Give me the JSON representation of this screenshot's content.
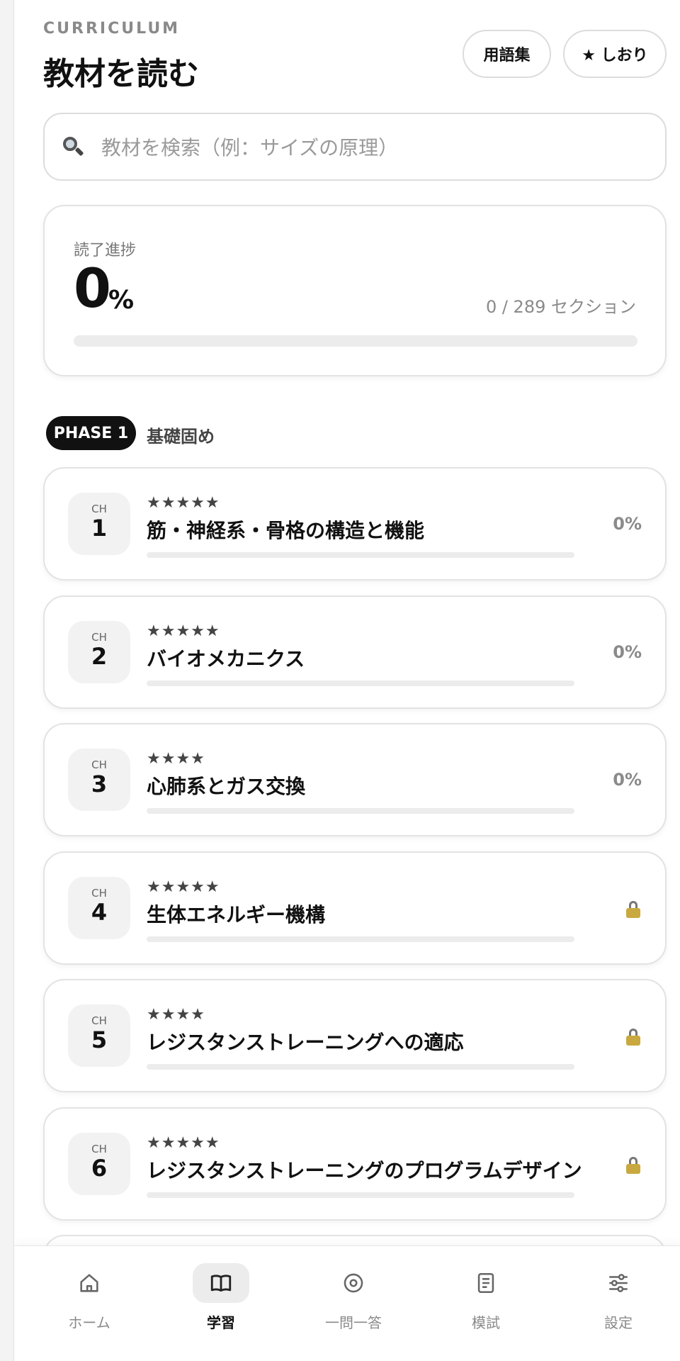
{
  "header": {
    "eyebrow": "CURRICULUM",
    "title": "教材を読む",
    "glossary_button": "用語集",
    "bookmark_button": "★ しおり"
  },
  "search": {
    "placeholder": "教材を検索（例：サイズの原理）"
  },
  "progress": {
    "label": "読了進捗",
    "value": "0",
    "unit": "%",
    "count_text": "0 / 289 セクション",
    "fraction": 0
  },
  "phase": {
    "badge": "PHASE 1",
    "title": "基礎固め"
  },
  "chapter_label": "CH",
  "chapters": [
    {
      "num": "1",
      "stars": "★★★★★",
      "title": "筋・神経系・骨格の構造と機能",
      "percent": "0%",
      "progress": 0,
      "locked": false
    },
    {
      "num": "2",
      "stars": "★★★★★",
      "title": "バイオメカニクス",
      "percent": "0%",
      "progress": 0,
      "locked": false
    },
    {
      "num": "3",
      "stars": "★★★★",
      "title": "心肺系とガス交換",
      "percent": "0%",
      "progress": 0,
      "locked": false
    },
    {
      "num": "4",
      "stars": "★★★★★",
      "title": "生体エネルギー機構",
      "percent": "",
      "progress": 0,
      "locked": true
    },
    {
      "num": "5",
      "stars": "★★★★",
      "title": "レジスタンストレーニングへの適応",
      "percent": "",
      "progress": 0,
      "locked": true
    },
    {
      "num": "6",
      "stars": "★★★★★",
      "title": "レジスタンストレーニングのプログラムデザイン",
      "percent": "",
      "progress": 0,
      "locked": true
    }
  ],
  "nav": {
    "items": [
      {
        "label": "ホーム",
        "icon": "home-icon",
        "active": false
      },
      {
        "label": "学習",
        "icon": "book-icon",
        "active": true
      },
      {
        "label": "一問一答",
        "icon": "target-icon",
        "active": false
      },
      {
        "label": "模試",
        "icon": "document-icon",
        "active": false
      },
      {
        "label": "設定",
        "icon": "sliders-icon",
        "active": false
      }
    ]
  },
  "colors": {
    "accent": "#111111",
    "muted": "#8a8a8a",
    "lock": "#c9a93f"
  }
}
